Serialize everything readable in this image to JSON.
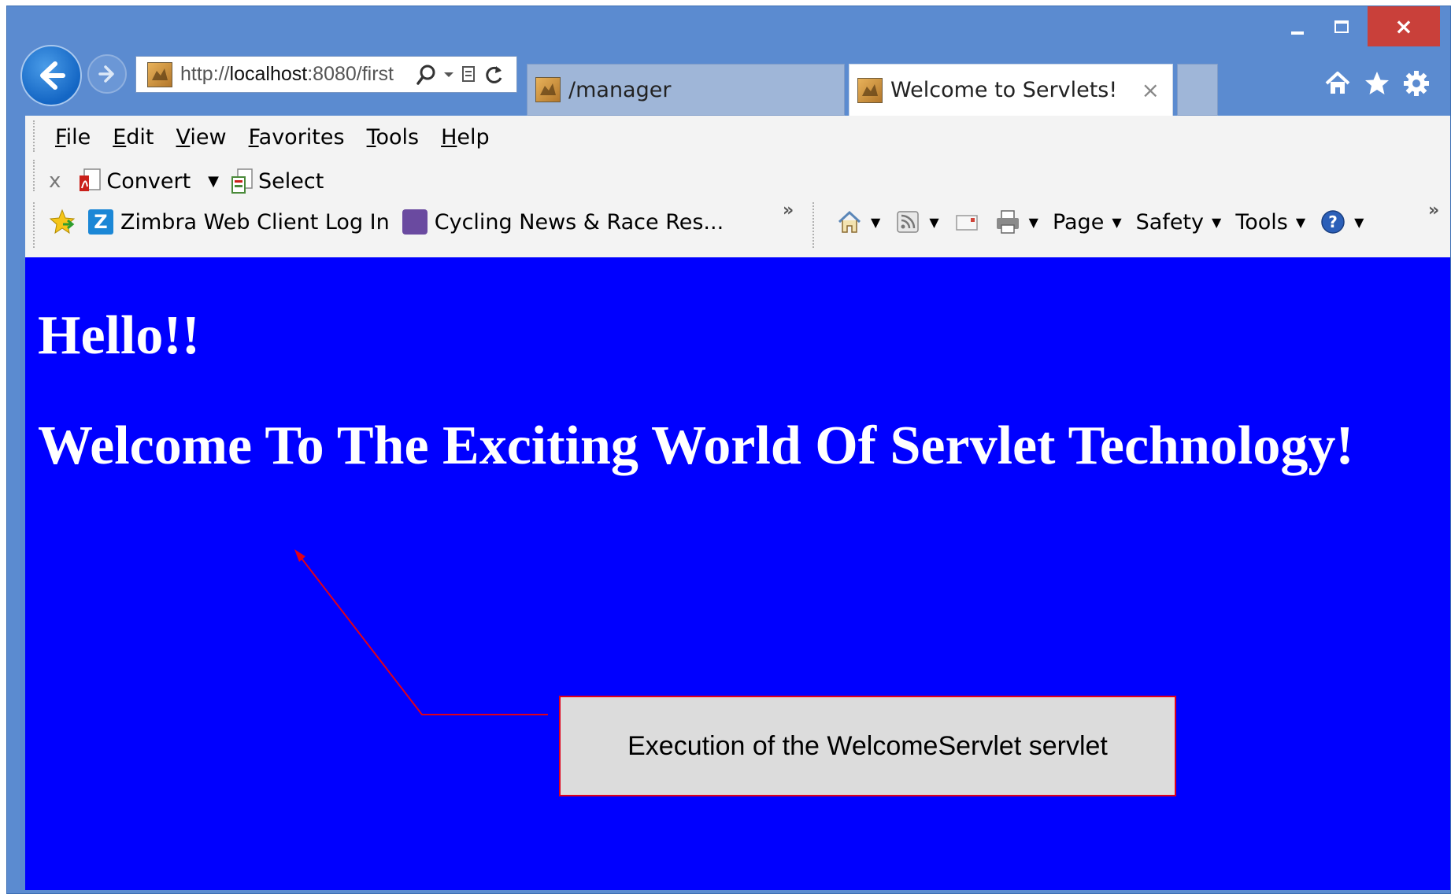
{
  "window": {
    "minimize_label": "",
    "maximize_label": "",
    "close_label": "×"
  },
  "address_bar": {
    "url_prefix": "http://",
    "url_host": "localhost",
    "url_rest": ":8080/first"
  },
  "tabs": [
    {
      "label": "/manager"
    },
    {
      "label": "Welcome to Servlets!",
      "close": "×"
    }
  ],
  "menu": {
    "items": [
      "File",
      "Edit",
      "View",
      "Favorites",
      "Tools",
      "Help"
    ]
  },
  "pdf_toolbar": {
    "close": "x",
    "convert": "Convert",
    "select": "Select"
  },
  "favorites_bar": {
    "items": [
      "Zimbra Web Client Log In",
      "Cycling News & Race Res..."
    ],
    "chevron": "»"
  },
  "command_bar": {
    "page": "Page",
    "safety": "Safety",
    "tools": "Tools",
    "chevron": "»"
  },
  "content": {
    "greeting": "Hello!!",
    "headline": "Welcome To The Exciting World Of Servlet Technology!",
    "background": "#0000ff"
  },
  "annotation": {
    "text": "Execution of the WelcomeServlet servlet",
    "color": "#e0001a"
  }
}
